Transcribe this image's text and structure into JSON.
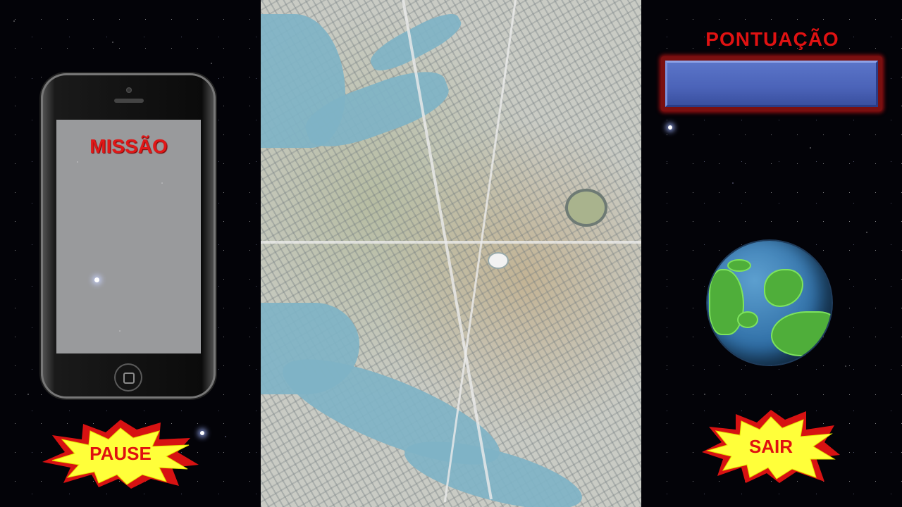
{
  "phone": {
    "title": "MISSÃO"
  },
  "score": {
    "title": "PONTUAÇÃO",
    "value": ""
  },
  "buttons": {
    "pause_label": "PAUSE",
    "exit_label": "SAIR"
  },
  "colors": {
    "title_red": "#e01818",
    "score_blue": "#4b63b8",
    "burst_yellow": "#ffff3a",
    "burst_red": "#d71212"
  },
  "icons": {
    "phone": "smartphone-icon",
    "earth": "earth-globe-icon",
    "map": "city-aerial-map"
  }
}
